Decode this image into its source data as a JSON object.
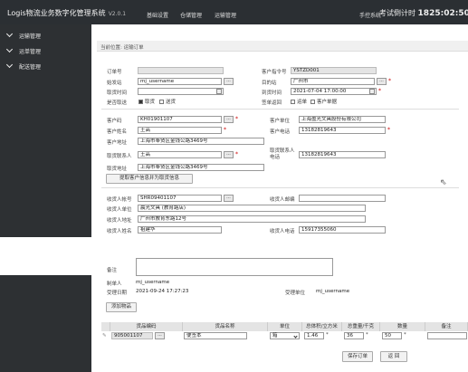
{
  "app": {
    "title": "Logis物流业务数字化管理系统",
    "version": "V2.0.1",
    "nav": [
      "基础设置",
      "仓储管理",
      "运输管理"
    ],
    "system": "手控系统",
    "countdown_label": "考试倒计时",
    "countdown": "1825:02:50"
  },
  "sidebar": {
    "items": [
      "运输管理",
      "运单管理",
      "配送管理"
    ]
  },
  "breadcrumb": "当前位置: 运输订单",
  "order": {
    "order_no_label": "订单号",
    "order_no": "",
    "customer_order_label": "客户指令号",
    "customer_order": "YSTZD001",
    "origin_label": "始发站",
    "origin": "mj_username",
    "dest_label": "目的站",
    "dest": "广州市",
    "pickup_time_label": "取货时间",
    "pickup_time": "",
    "arrival_time_label": "到货时间",
    "arrival_time": "2021-07-04 17:00:00",
    "delivery_label": "是否取送",
    "pickup_opt": "取货",
    "deliver_opt": "送货",
    "receipt_label": "签单返回",
    "receipt_opt1": "运单",
    "receipt_opt2": "客户单据"
  },
  "customer": {
    "code_label": "客户码",
    "code": "KH01901107",
    "unit_label": "客户单位",
    "unit": "上海盈光文具股份有限公司",
    "name_label": "客户姓名",
    "name": "王高",
    "phone_label": "客户电话",
    "phone": "13182819643",
    "address_label": "客户地址",
    "address": "上海市奉贤区金钱公路3469号",
    "pickup_contact_label": "取货联系人",
    "pickup_contact": "王高",
    "pickup_phone_label": "取货联系人电话",
    "pickup_phone": "13182819643",
    "pickup_addr_label": "取货地址",
    "pickup_addr": "上海市奉贤区金钱公路3469号",
    "fetch_btn": "提取客户信息并为取货信息"
  },
  "receiver": {
    "acct_label": "收货人帐号",
    "acct": "SHR09401107",
    "email_label": "收货人邮编",
    "email": "",
    "unit_label": "收货人单位",
    "unit": "晨光文具 (教育路店)",
    "addr_label": "收货人地址",
    "addr": "广州市教育东路12号",
    "name_label": "收货人姓名",
    "name": "祖建华",
    "phone_label": "收货人电话",
    "phone": "15917355060"
  },
  "notes": {
    "remark_label": "备注",
    "remark": "",
    "maker_label": "制单人",
    "maker": "mj_username",
    "date_label": "受理日期",
    "date": "2021-09-24 17:27:23",
    "unit_label": "受理单位",
    "unit": "mj_username"
  },
  "goods": {
    "add_btn": "添加物品",
    "headers": [
      "货品编码",
      "货品名称",
      "单位",
      "总体积/立方米",
      "总重量/千克",
      "数量",
      "备注"
    ],
    "row": {
      "code": "905001107",
      "name": "便签本",
      "unit": "箱",
      "volume": "1.46",
      "weight": "36",
      "qty": "50",
      "remark": ""
    }
  },
  "actions": {
    "save": "保存订单",
    "back": "返 回"
  }
}
